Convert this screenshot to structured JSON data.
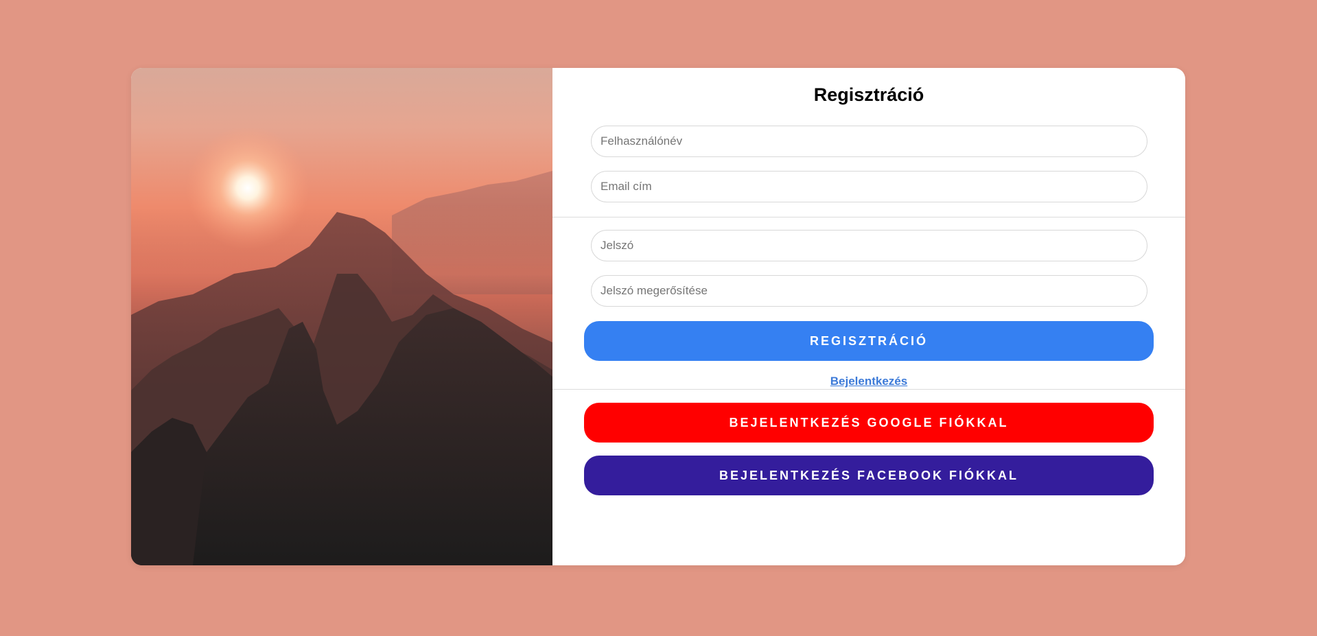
{
  "form": {
    "title": "Regisztráció",
    "fields": {
      "username": {
        "placeholder": "Felhasználónév",
        "value": ""
      },
      "email": {
        "placeholder": "Email cím",
        "value": ""
      },
      "password": {
        "placeholder": "Jelszó",
        "value": ""
      },
      "password_confirm": {
        "placeholder": "Jelszó megerősítése",
        "value": ""
      }
    },
    "register_button": "REGISZTRÁCIÓ",
    "login_link": "Bejelentkezés",
    "google_button": "BEJELENTKEZÉS GOOGLE FIÓKKAL",
    "facebook_button": "BEJELENTKEZÉS FACEBOOK FIÓKKAL"
  },
  "colors": {
    "page_background": "#e19684",
    "register": "#3580f2",
    "google": "#ff0000",
    "facebook": "#341d9c",
    "link": "#3c7ad8"
  },
  "image": {
    "subject": "sunset over misty mountains"
  }
}
